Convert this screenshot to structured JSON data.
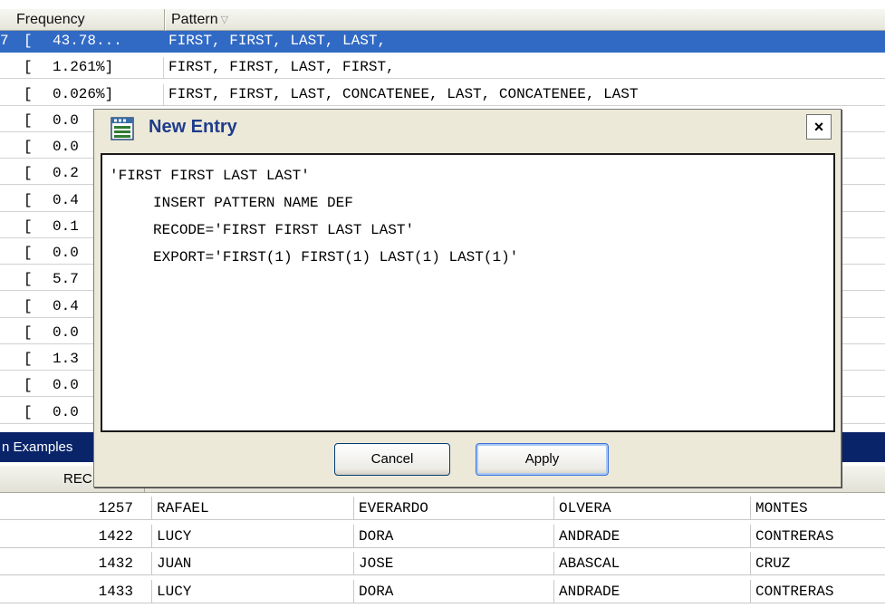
{
  "frequency_table": {
    "header_frequency": "Frequency",
    "header_pattern": "Pattern",
    "rows": [
      {
        "lead": "7",
        "bracket": "[",
        "pct": "43.78...",
        "pattern": "FIRST, FIRST, LAST, LAST,",
        "selected": true
      },
      {
        "lead": "",
        "bracket": "[",
        "pct": "1.261%]",
        "pattern": "FIRST, FIRST, LAST, FIRST,"
      },
      {
        "lead": "",
        "bracket": "[",
        "pct": "0.026%]",
        "pattern": "FIRST, FIRST, LAST, CONCATENEE, LAST, CONCATENEE, LAST"
      },
      {
        "lead": "",
        "bracket": "[",
        "pct": "0.0",
        "pattern": ""
      },
      {
        "lead": "",
        "bracket": "[",
        "pct": "0.0",
        "pattern": ""
      },
      {
        "lead": "",
        "bracket": "[",
        "pct": "0.2",
        "pattern": ""
      },
      {
        "lead": "",
        "bracket": "[",
        "pct": "0.4",
        "pattern": ""
      },
      {
        "lead": "",
        "bracket": "[",
        "pct": "0.1",
        "pattern": ""
      },
      {
        "lead": "",
        "bracket": "[",
        "pct": "0.0",
        "pattern": ""
      },
      {
        "lead": "",
        "bracket": "[",
        "pct": "5.7",
        "pattern": ""
      },
      {
        "lead": "",
        "bracket": "[",
        "pct": "0.4",
        "pattern": ""
      },
      {
        "lead": "",
        "bracket": "[",
        "pct": "0.0",
        "pattern": ""
      },
      {
        "lead": "",
        "bracket": "[",
        "pct": "1.3",
        "pattern": ""
      },
      {
        "lead": "",
        "bracket": "[",
        "pct": "0.0",
        "pattern": ""
      },
      {
        "lead": "",
        "bracket": "[",
        "pct": "0.0",
        "pattern": ""
      }
    ]
  },
  "examples": {
    "title": "n Examples",
    "header_rec": "REC",
    "rows": [
      {
        "rec": "1257",
        "a": "RAFAEL",
        "b": "EVERARDO",
        "c": "OLVERA",
        "d": "MONTES"
      },
      {
        "rec": "1422",
        "a": "LUCY",
        "b": "DORA",
        "c": "ANDRADE",
        "d": "CONTRERAS"
      },
      {
        "rec": "1432",
        "a": "JUAN",
        "b": "JOSE",
        "c": "ABASCAL",
        "d": "CRUZ"
      },
      {
        "rec": "1433",
        "a": "LUCY",
        "b": "DORA",
        "c": "ANDRADE",
        "d": "CONTRERAS"
      }
    ]
  },
  "dialog": {
    "title": "New Entry",
    "close_label": "×",
    "text": "'FIRST FIRST LAST LAST'\n     INSERT PATTERN NAME DEF\n     RECODE='FIRST FIRST LAST LAST'\n     EXPORT='FIRST(1) FIRST(1) LAST(1) LAST(1)'",
    "cancel_label": "Cancel",
    "apply_label": "Apply"
  },
  "colors": {
    "selection": "#316ac5",
    "panel_title": "#0a246a",
    "dialog_bg": "#ece9d8",
    "dialog_title": "#1e3c8c"
  },
  "icons": {
    "sort": "sort-indicator-icon",
    "app": "window-app-icon",
    "close": "close-icon"
  }
}
